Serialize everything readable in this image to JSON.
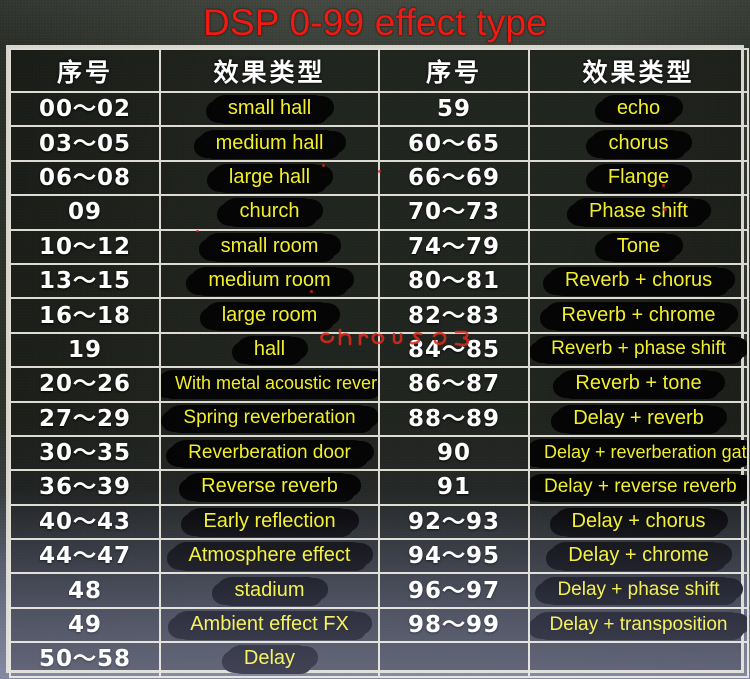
{
  "title": "DSP 0-99 effect type",
  "headers": {
    "number": "序号",
    "effect": "效果类型"
  },
  "colors": {
    "title": "#ef1b12",
    "effect_text": "#f2ef2a",
    "number_text": "#ffffff",
    "redaction": "#050505",
    "grid": "#dedcd2",
    "background": "#3b4038"
  },
  "table": {
    "left": [
      {
        "number": "00～02",
        "effect": "small hall"
      },
      {
        "number": "03～05",
        "effect": "medium hall"
      },
      {
        "number": "06～08",
        "effect": "large hall"
      },
      {
        "number": "09",
        "effect": "church"
      },
      {
        "number": "10～12",
        "effect": "small room"
      },
      {
        "number": "13～15",
        "effect": "medium room"
      },
      {
        "number": "16～18",
        "effect": "large room"
      },
      {
        "number": "19",
        "effect": "hall"
      },
      {
        "number": "20～26",
        "effect": "With metal acoustic reverb"
      },
      {
        "number": "27～29",
        "effect": "Spring reverberation"
      },
      {
        "number": "30～35",
        "effect": "Reverberation door"
      },
      {
        "number": "36～39",
        "effect": "Reverse reverb"
      },
      {
        "number": "40～43",
        "effect": "Early reflection"
      },
      {
        "number": "44～47",
        "effect": "Atmosphere effect"
      },
      {
        "number": "48",
        "effect": "stadium"
      },
      {
        "number": "49",
        "effect": "Ambient effect FX"
      },
      {
        "number": "50～58",
        "effect": "Delay"
      }
    ],
    "right": [
      {
        "number": "59",
        "effect": "echo"
      },
      {
        "number": "60～65",
        "effect": "chorus"
      },
      {
        "number": "66～69",
        "effect": "Flange"
      },
      {
        "number": "70～73",
        "effect": "Phase shift"
      },
      {
        "number": "74～79",
        "effect": "Tone"
      },
      {
        "number": "80～81",
        "effect": "Reverb + chorus"
      },
      {
        "number": "82～83",
        "effect": "Reverb + chrome"
      },
      {
        "number": "84～85",
        "effect": "Reverb + phase shift"
      },
      {
        "number": "86～87",
        "effect": "Reverb + tone"
      },
      {
        "number": "88～89",
        "effect": "Delay + reverb"
      },
      {
        "number": "90",
        "effect": "Delay + reverberation gate"
      },
      {
        "number": "91",
        "effect": "Delay + reverse reverb"
      },
      {
        "number": "92～93",
        "effect": "Delay + chorus"
      },
      {
        "number": "94～95",
        "effect": "Delay + chrome"
      },
      {
        "number": "96～97",
        "effect": "Delay + phase shift"
      },
      {
        "number": "98～99",
        "effect": "Delay + transposition"
      },
      {
        "number": "",
        "effect": ""
      }
    ]
  },
  "annotations": {
    "red_scribble": "chorus"
  }
}
